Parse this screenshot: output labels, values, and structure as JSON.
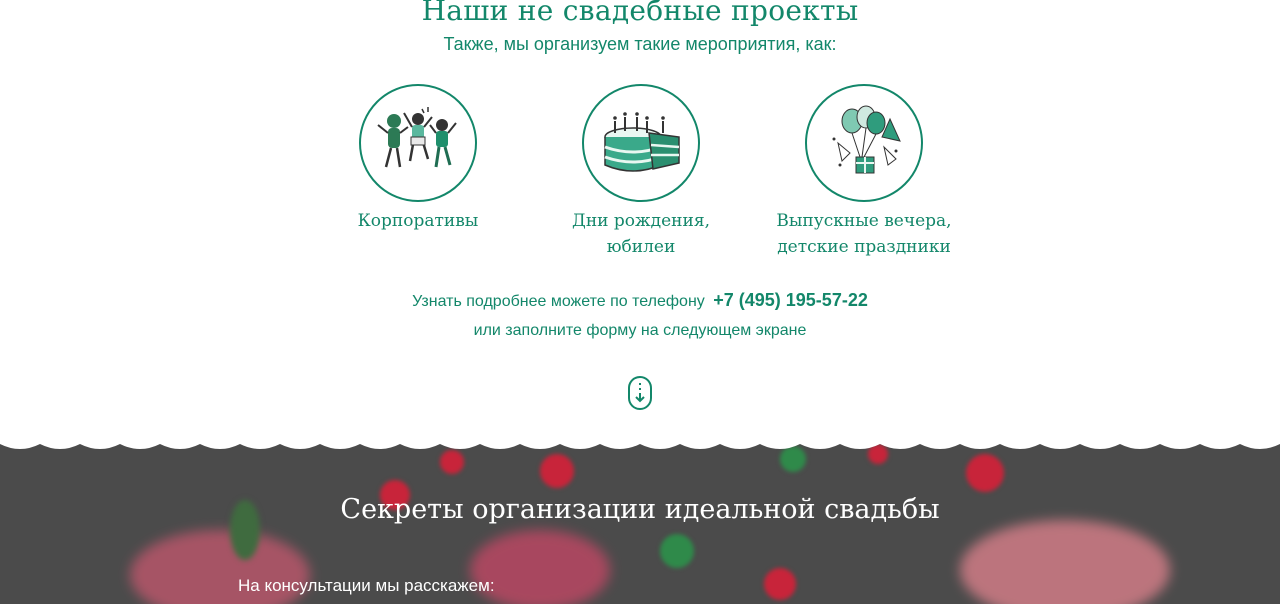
{
  "section": {
    "title": "Наши не свадебные проекты",
    "subtitle": "Также, мы организуем такие мероприятия, как:"
  },
  "events": [
    {
      "line1": "Корпоративы",
      "line2": "",
      "icon": "dancing-people-icon"
    },
    {
      "line1": "Дни рождения,",
      "line2": "юбилеи",
      "icon": "birthday-cake-icon"
    },
    {
      "line1": "Выпускные вечера,",
      "line2": "детские праздники",
      "icon": "balloons-icon"
    }
  ],
  "contact": {
    "prefix": "Узнать подробнее можете по телефону",
    "phone": "+7 (495) 195-57-22",
    "line2": "или заполните форму на следующем экране"
  },
  "scroll_button": {
    "icon": "scroll-down-icon"
  },
  "secrets": {
    "title": "Секреты организации идеальной свадьбы",
    "consult_label": "На консультации мы расскажем:"
  },
  "colors": {
    "accent": "#13876a",
    "dark_bg": "#4b4b4b",
    "decor_red": "#c8243a",
    "decor_green": "#2f8a4a"
  }
}
